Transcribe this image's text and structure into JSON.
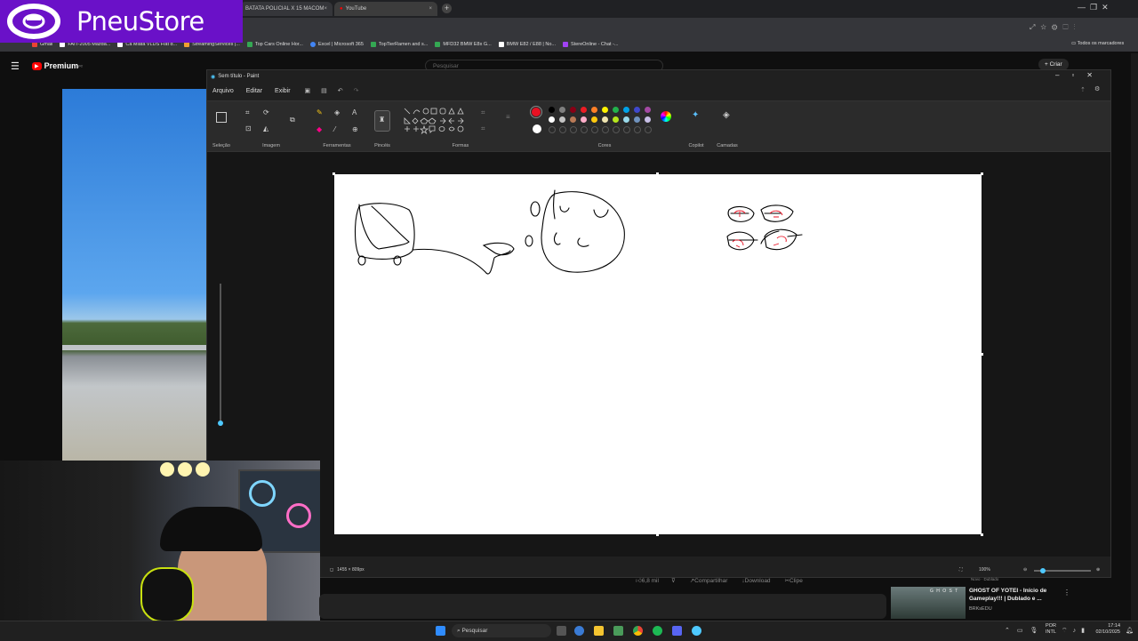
{
  "browser": {
    "tabs": [
      {
        "label": "BATATA POLICIAL X 15 MACOM",
        "close": "×"
      },
      {
        "label": "YouTube",
        "close": "×"
      }
    ],
    "new_tab": "+",
    "bookmarks": [
      {
        "label": "Gmail",
        "color": "#ea4335"
      },
      {
        "label": "FAIT-2005 Mazda...",
        "color": "#ffffff"
      },
      {
        "label": "Ca Miata VLDS Fiat d...",
        "color": "#ffffff"
      },
      {
        "label": "StreamingServices |...",
        "color": "#f0a030"
      },
      {
        "label": "Top Cars Online Hor...",
        "color": "#34a853"
      },
      {
        "label": "Excel | Microsoft 365",
        "color": "#4285f4"
      },
      {
        "label": "TopTierRamen and s...",
        "color": "#34a853"
      },
      {
        "label": "MFD32 BMW E8x G...",
        "color": "#34a853"
      },
      {
        "label": "BMW E82 / E88 | No...",
        "color": "#ffffff"
      },
      {
        "label": "StereOnline - Chat -...",
        "color": "#a142f4"
      }
    ],
    "all_bookmarks": "Todos os marcadores"
  },
  "logo": {
    "text": "PneuStore"
  },
  "youtube": {
    "brand": "Premium",
    "brand_sup": "PT",
    "search_placeholder": "Pesquisar",
    "create_label": "Criar",
    "actions": {
      "likes": "6,8 mil",
      "share": "Compartilhar",
      "download": "Download",
      "clip": "Clipe"
    },
    "suggestion": {
      "badge": "Novo",
      "badge2": "Dublado",
      "title_line1": "GHOST OF YOTEI - Início de",
      "title_line2": "Gameplay!!! | Dublado e ...",
      "channel": "BRKsEDU"
    }
  },
  "paint": {
    "title": "Sem título - Paint",
    "menu": [
      "Arquivo",
      "Editar",
      "Exibir"
    ],
    "groups": [
      "Seleção",
      "Imagem",
      "Ferramentas",
      "Pincéis",
      "Formas",
      "Cores",
      "Copilot",
      "Camadas"
    ],
    "palette_row1": [
      "#000000",
      "#7f7f7f",
      "#880015",
      "#ed1c24",
      "#ff7f27",
      "#fff200",
      "#22b14c",
      "#00a2e8",
      "#3f48cc",
      "#a349a4"
    ],
    "palette_row2": [
      "#ffffff",
      "#c3c3c3",
      "#b97a57",
      "#ffaec9",
      "#ffc90e",
      "#efe4b0",
      "#b5e61d",
      "#99d9ea",
      "#7092be",
      "#c8bfe7"
    ],
    "primary_color": "#e81123",
    "secondary_color": "#ffffff",
    "status": {
      "dimensions": "1455 × 809px",
      "zoom": "100%"
    }
  },
  "taskbar": {
    "search": "Pesquisar",
    "lang": "POR",
    "lang2": "INTL",
    "time": "17:14",
    "date": "02/10/2025"
  }
}
